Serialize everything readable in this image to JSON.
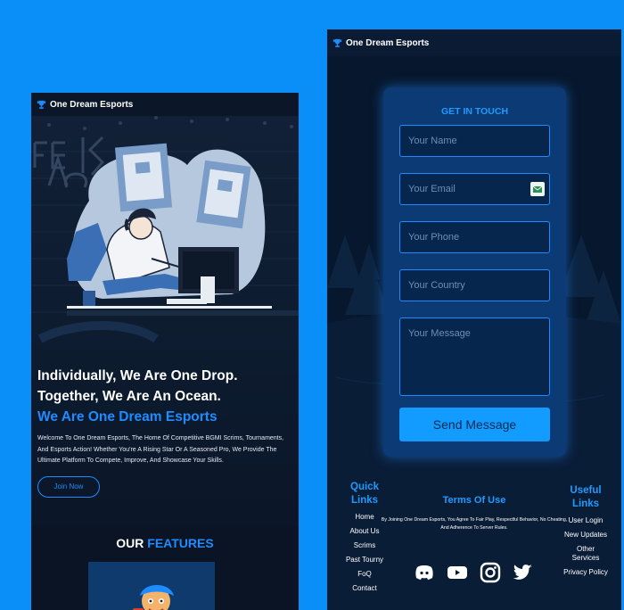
{
  "colors": {
    "page_bg": "#0a8ef8",
    "accent": "#1e8cff",
    "panel": "#0b3a74",
    "dark": "#0a1424"
  },
  "left_phone": {
    "brand": "One Dream Esports",
    "hero": {
      "line1": "Individually, We Are One Drop.",
      "line2": "Together, We Are An Ocean.",
      "line3": "We Are One Dream Esports",
      "intro": "Welcome To One Dream Esports, The Home Of Competitive BGMI Scrims, Tournaments, And Esports Action! Whether You're A Rising Star Or A Seasoned Pro, We Provide The Ultimate Platform To Compete, Improve, And Showcase Your Skills.",
      "join_label": "Join Now"
    },
    "features": {
      "word1": "OUR",
      "word2": "FEATURES"
    }
  },
  "right_phone": {
    "brand": "One Dream Esports",
    "form": {
      "title": "GET IN TOUCH",
      "name_placeholder": "Your Name",
      "email_placeholder": "Your Email",
      "phone_placeholder": "Your Phone",
      "country_placeholder": "Your Country",
      "message_placeholder": "Your Message",
      "send_label": "Send Message"
    },
    "footer": {
      "quick_title": "Quick Links",
      "quick_items": [
        "Home",
        "About Us",
        "Scrims",
        "Past Tourny",
        "FoQ",
        "Contact"
      ],
      "terms_title": "Terms Of Use",
      "terms_text": "By Joining One Dream Esports, You Agree To Fair Play, Respectful Behavior, No Cheating, And Adherence To Server Rules.",
      "useful_title": "Useful Links",
      "useful_items": [
        "User Login",
        "New Updates",
        "Other Services",
        "Privacy Policy"
      ],
      "social_icons": [
        "discord-icon",
        "youtube-icon",
        "instagram-icon",
        "twitter-icon"
      ]
    }
  }
}
